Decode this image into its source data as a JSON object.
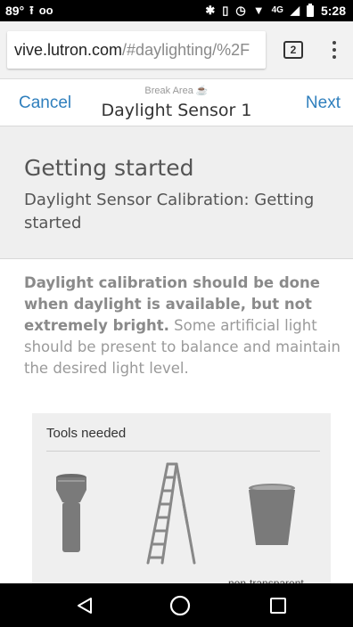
{
  "status_bar": {
    "battery_level_text": "89°",
    "time": "5:28",
    "network": "4G"
  },
  "browser": {
    "url_host": "vive.lutron.com",
    "url_path": "/#daylighting/%2F",
    "tab_count": "2"
  },
  "header": {
    "cancel_label": "Cancel",
    "area_label": "Break Area ☕",
    "title": "Daylight Sensor 1",
    "next_label": "Next"
  },
  "section": {
    "title": "Getting started",
    "subtitle": "Daylight Sensor Calibration: Getting started"
  },
  "body": {
    "bold_text": "Daylight calibration should be done when daylight is available, but not extremely bright.",
    "normal_text": " Some artificial light should be present to balance and maintain the desired light level."
  },
  "tools": {
    "heading": "Tools needed",
    "items": [
      {
        "icon": "flashlight-icon"
      },
      {
        "icon": "ladder-icon"
      },
      {
        "icon": "cup-icon",
        "caption": "non-transparent"
      }
    ]
  }
}
